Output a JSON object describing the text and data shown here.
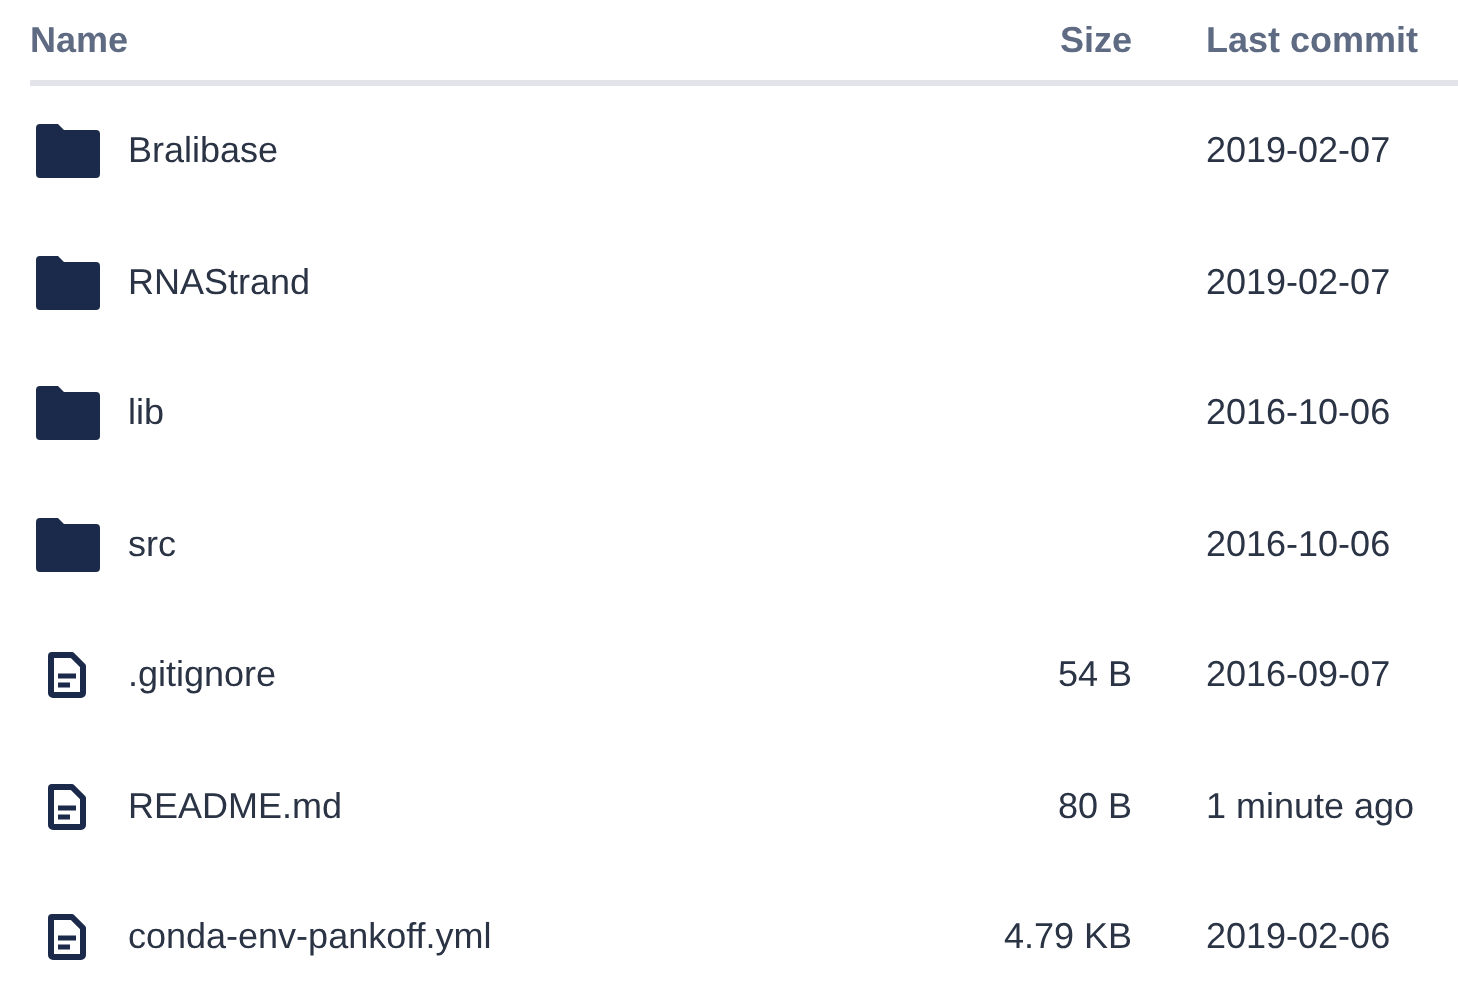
{
  "table": {
    "columns": [
      "Name",
      "Size",
      "Last commit"
    ],
    "rows": [
      {
        "kind": "folder",
        "name": "Bralibase",
        "last_commit": "2019-02-07"
      },
      {
        "kind": "folder",
        "name": "RNAStrand",
        "last_commit": "2019-02-07"
      },
      {
        "kind": "folder",
        "name": "lib",
        "last_commit": "2016-10-06"
      },
      {
        "kind": "folder",
        "name": "src",
        "last_commit": "2016-10-06"
      },
      {
        "kind": "file",
        "name": ".gitignore",
        "size": "54 B",
        "last_commit": "2016-09-07"
      },
      {
        "kind": "file",
        "name": "README.md",
        "size": "80 B",
        "last_commit": "1 minute ago"
      },
      {
        "kind": "file",
        "name": "conda-env-pankoff.yml",
        "size": "4.79 KB",
        "last_commit": "2019-02-06"
      }
    ]
  }
}
